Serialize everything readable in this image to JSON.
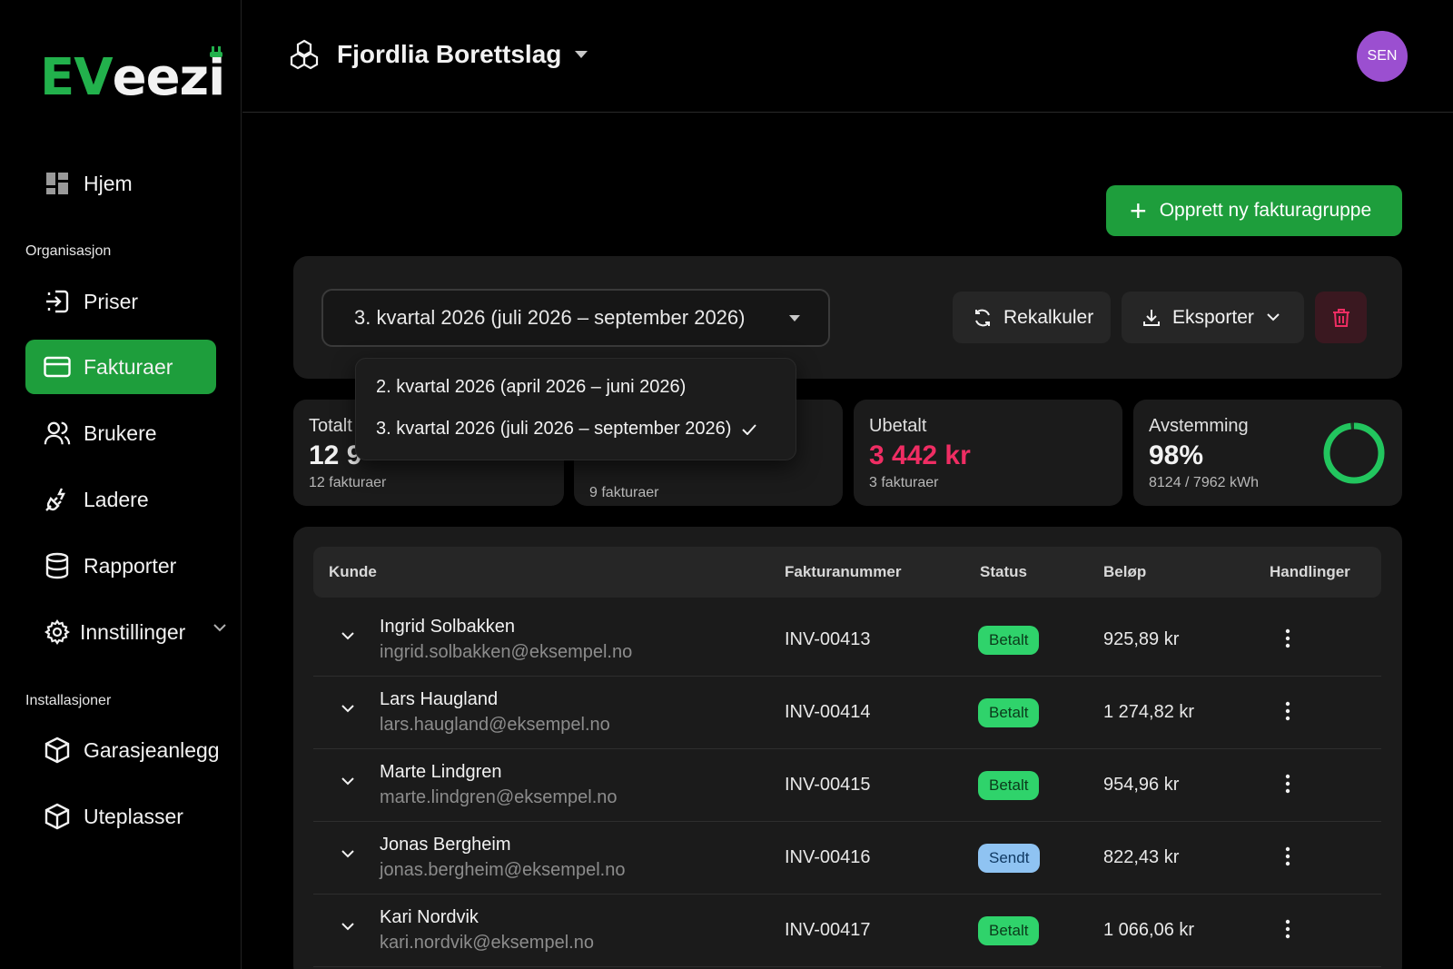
{
  "brand": {
    "ev": "EV",
    "eezi": "eezi"
  },
  "sidebar": {
    "home": "Hjem",
    "section_org": "Organisasjon",
    "prices": "Priser",
    "invoices": "Fakturaer",
    "users": "Brukere",
    "chargers": "Ladere",
    "reports": "Rapporter",
    "settings": "Innstillinger",
    "section_install": "Installasjoner",
    "garage": "Garasjeanlegg",
    "outdoor": "Uteplasser"
  },
  "header": {
    "org_name": "Fjordlia Borettslag",
    "avatar": "SEN"
  },
  "actions": {
    "create_group": "Opprett ny fakturagruppe",
    "recalc": "Rekalkuler",
    "export": "Eksporter"
  },
  "period": {
    "selected": "3. kvartal 2026 (juli 2026 – september 2026)",
    "options": [
      "2. kvartal 2026 (april 2026 – juni 2026)",
      "3. kvartal 2026 (juli 2026 – september 2026)"
    ]
  },
  "stats": {
    "total": {
      "label": "Totalt",
      "value": "12 9",
      "sub": "12 fakturaer"
    },
    "paid": {
      "sub": "9 fakturaer"
    },
    "unpaid": {
      "label": "Ubetalt",
      "value": "3 442 kr",
      "sub": "3 fakturaer"
    },
    "reconciliation": {
      "label": "Avstemming",
      "value": "98%",
      "sub": "8124 / 7962 kWh",
      "progress": 0.98
    }
  },
  "table": {
    "headers": [
      "Kunde",
      "Fakturanummer",
      "Status",
      "Beløp",
      "Handlinger"
    ],
    "rows": [
      {
        "name": "Ingrid Solbakken",
        "email": "ingrid.solbakken@eksempel.no",
        "invoice": "INV-00413",
        "status": "Betalt",
        "amount": "925,89 kr"
      },
      {
        "name": "Lars Haugland",
        "email": "lars.haugland@eksempel.no",
        "invoice": "INV-00414",
        "status": "Betalt",
        "amount": "1 274,82 kr"
      },
      {
        "name": "Marte Lindgren",
        "email": "marte.lindgren@eksempel.no",
        "invoice": "INV-00415",
        "status": "Betalt",
        "amount": "954,96 kr"
      },
      {
        "name": "Jonas Bergheim",
        "email": "jonas.bergheim@eksempel.no",
        "invoice": "INV-00416",
        "status": "Sendt",
        "amount": "822,43 kr"
      },
      {
        "name": "Kari Nordvik",
        "email": "kari.nordvik@eksempel.no",
        "invoice": "INV-00417",
        "status": "Betalt",
        "amount": "1 066,06 kr"
      }
    ]
  },
  "colors": {
    "accent": "#1e9e3c",
    "unpaid": "#ef2d63",
    "avatar": "#9b4fd0",
    "paid_badge": "#2fd36b",
    "sent_badge": "#8fc3f2"
  }
}
